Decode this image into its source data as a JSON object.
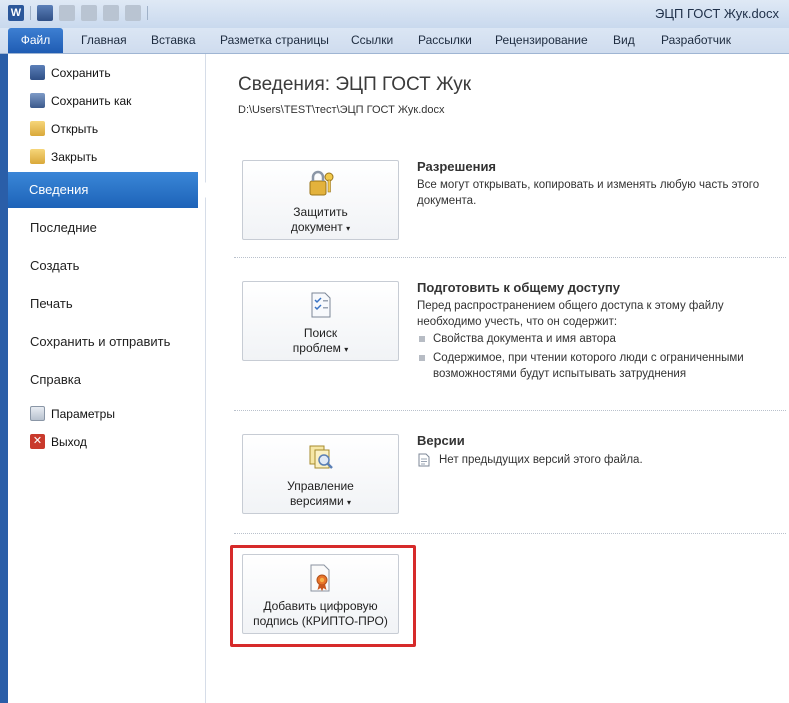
{
  "window": {
    "title": "ЭЦП ГОСТ Жук.docx",
    "app_icon_letter": "W"
  },
  "tabs": [
    "Главная",
    "Вставка",
    "Разметка страницы",
    "Ссылки",
    "Рассылки",
    "Рецензирование",
    "Вид",
    "Разработчик"
  ],
  "file_tab": "Файл",
  "nav": {
    "small_top": [
      "Сохранить",
      "Сохранить как",
      "Открыть",
      "Закрыть"
    ],
    "selected": "Сведения",
    "big": [
      "Последние",
      "Создать",
      "Печать",
      "Сохранить и отправить",
      "Справка"
    ],
    "small_bottom": [
      "Параметры",
      "Выход"
    ]
  },
  "main": {
    "title": "Сведения: ЭЦП ГОСТ Жук",
    "path": "D:\\Users\\TEST\\тест\\ЭЦП ГОСТ Жук.docx",
    "protect": {
      "button_line1": "Защитить",
      "button_line2": "документ",
      "heading": "Разрешения",
      "text": "Все могут открывать, копировать и изменять любую часть этого документа."
    },
    "inspect": {
      "button_line1": "Поиск",
      "button_line2": "проблем",
      "heading": "Подготовить к общему доступу",
      "text": "Перед распространением общего доступа к этому файлу необходимо учесть, что он содержит:",
      "bullets": [
        "Свойства документа и имя автора",
        "Содержимое, при чтении которого люди с ограниченными возможностями будут испытывать затруднения"
      ]
    },
    "versions": {
      "button_line1": "Управление",
      "button_line2": "версиями",
      "heading": "Версии",
      "text": "Нет предыдущих версий этого файла."
    },
    "signature": {
      "button_line1": "Добавить цифровую",
      "button_line2": "подпись (КРИПТО-ПРО)"
    }
  },
  "colors": {
    "file_tab": "#1f5cb3",
    "selected_nav": "#2a6fc4",
    "highlight": "#d62a2a"
  }
}
